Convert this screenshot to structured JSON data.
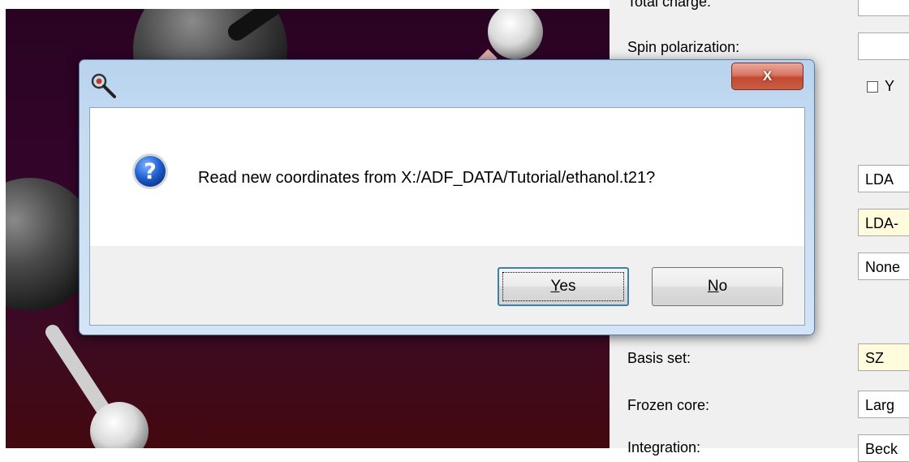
{
  "dialog": {
    "close_label": "X",
    "message": "Read new coordinates from X:/ADF_DATA/Tutorial/ethanol.t21?",
    "message_icon": "question-icon",
    "title_icon": "magnifier-icon",
    "yes_label": "Yes",
    "no_label": "No"
  },
  "panel": {
    "total_charge_label": "Total charge:",
    "spin_polarization_label": "Spin polarization:",
    "checkbox_label": "Y",
    "checkbox_checked": false,
    "xc_field_1": "LDA",
    "xc_field_2": "LDA-",
    "xc_field_3": "None",
    "basis_set_label": "Basis set:",
    "basis_set_value": "SZ",
    "frozen_core_label": "Frozen core:",
    "frozen_core_value": "Larg",
    "integration_label": "Integration:",
    "integration_value": "Beck"
  },
  "colors": {
    "viewport_bg": "#2a0322",
    "dialog_frame": "#c6dcf1",
    "close_button": "#c85e46",
    "highlight_field": "#fffbdc"
  }
}
